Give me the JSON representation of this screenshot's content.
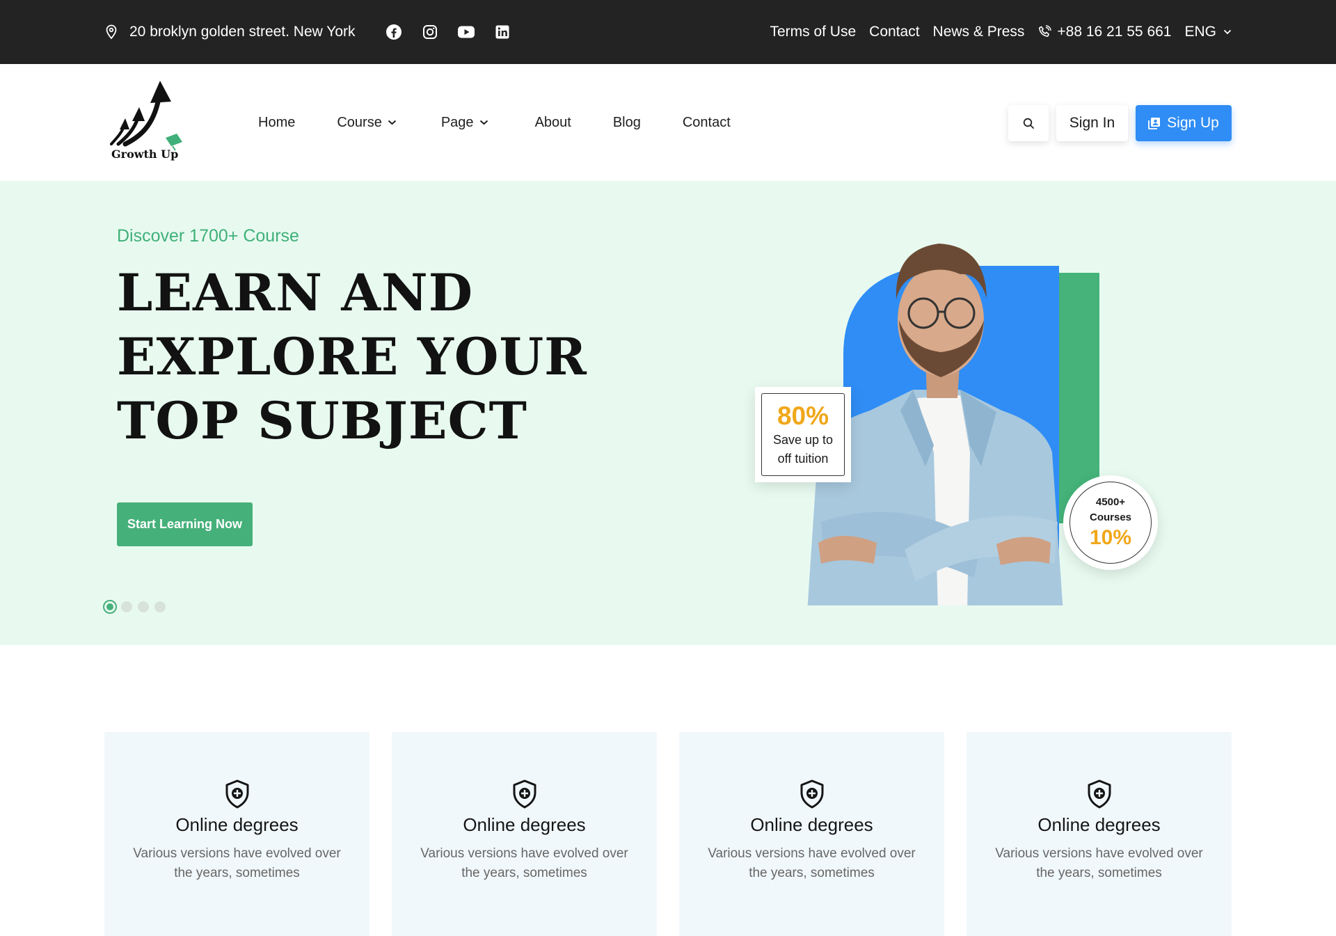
{
  "topbar": {
    "address": "20 broklyn golden street. New York",
    "social_icons": [
      "facebook-icon",
      "instagram-icon",
      "youtube-icon",
      "linkedin-icon"
    ],
    "links": [
      "Terms of Use",
      "Contact",
      "News & Press"
    ],
    "phone": "+88 16 21 55 661",
    "language": "ENG"
  },
  "header": {
    "logo_text": "Growth Up",
    "nav": [
      {
        "label": "Home"
      },
      {
        "label": "Course"
      },
      {
        "label": "Page"
      },
      {
        "label": "About"
      },
      {
        "label": "Blog"
      },
      {
        "label": "Contact"
      }
    ],
    "signin_label": "Sign In",
    "signup_label": "Sign Up"
  },
  "hero": {
    "subtitle": "Discover 1700+ Course",
    "title_lines": [
      "LEARN AND",
      "EXPLORE YOUR",
      "TOP SUBJECT"
    ],
    "cta_label": "Start Learning Now",
    "slide_count": 4,
    "active_slide": 1,
    "badge_save": {
      "percent": "80%",
      "line1": "Save up to",
      "line2": "off tuition"
    },
    "badge_courses": {
      "line1": "4500+",
      "line2": "Courses",
      "percent": "10%"
    }
  },
  "features": [
    {
      "title": "Online degrees",
      "desc": "Various versions have evolved over the years, sometimes",
      "icon": "shield-plus-icon"
    },
    {
      "title": "Online degrees",
      "desc": "Various versions have evolved over the years, sometimes",
      "icon": "shield-plus-icon"
    },
    {
      "title": "Online degrees",
      "desc": "Various versions have evolved over the years, sometimes",
      "icon": "shield-plus-icon"
    },
    {
      "title": "Online degrees",
      "desc": "Various versions have evolved over the years, sometimes",
      "icon": "shield-plus-icon"
    }
  ],
  "colors": {
    "topbar_bg": "#232323",
    "hero_bg": "#e8faf0",
    "accent_green": "#46b07a",
    "accent_blue": "#2f8df5",
    "accent_yellow": "#f0a71a",
    "feature_bg": "#f1f8fb"
  }
}
